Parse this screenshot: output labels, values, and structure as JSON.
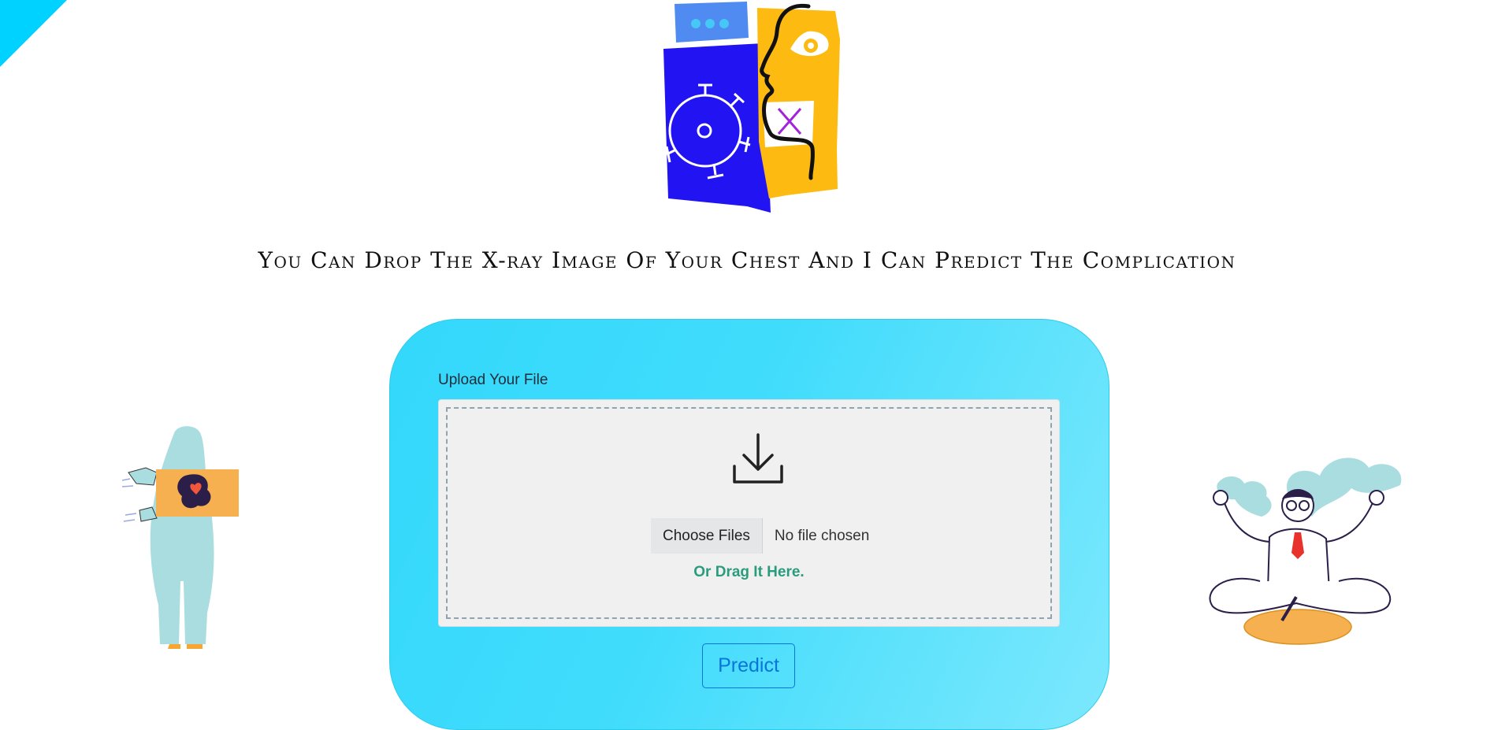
{
  "page": {
    "headline": "You Can Drop The X-ray Image Of Your Chest And I Can Predict The Complication"
  },
  "colors": {
    "corner_accent": "#00d2ff",
    "card_gradient_start": "#33d8fb",
    "card_gradient_end": "#7ce8fd",
    "drag_text": "#2a9c7c",
    "predict_button": "#0a75d8"
  },
  "illustrations": {
    "hero": "face-virus-xray-illustration",
    "left": "person-holding-xray-illustration",
    "right": "meditating-doctor-illustration"
  },
  "upload": {
    "label": "Upload Your File",
    "icon": "download-icon",
    "choose_button": "Choose Files",
    "file_status": "No file chosen",
    "drag_hint": "Or Drag It Here."
  },
  "actions": {
    "predict": "Predict"
  }
}
